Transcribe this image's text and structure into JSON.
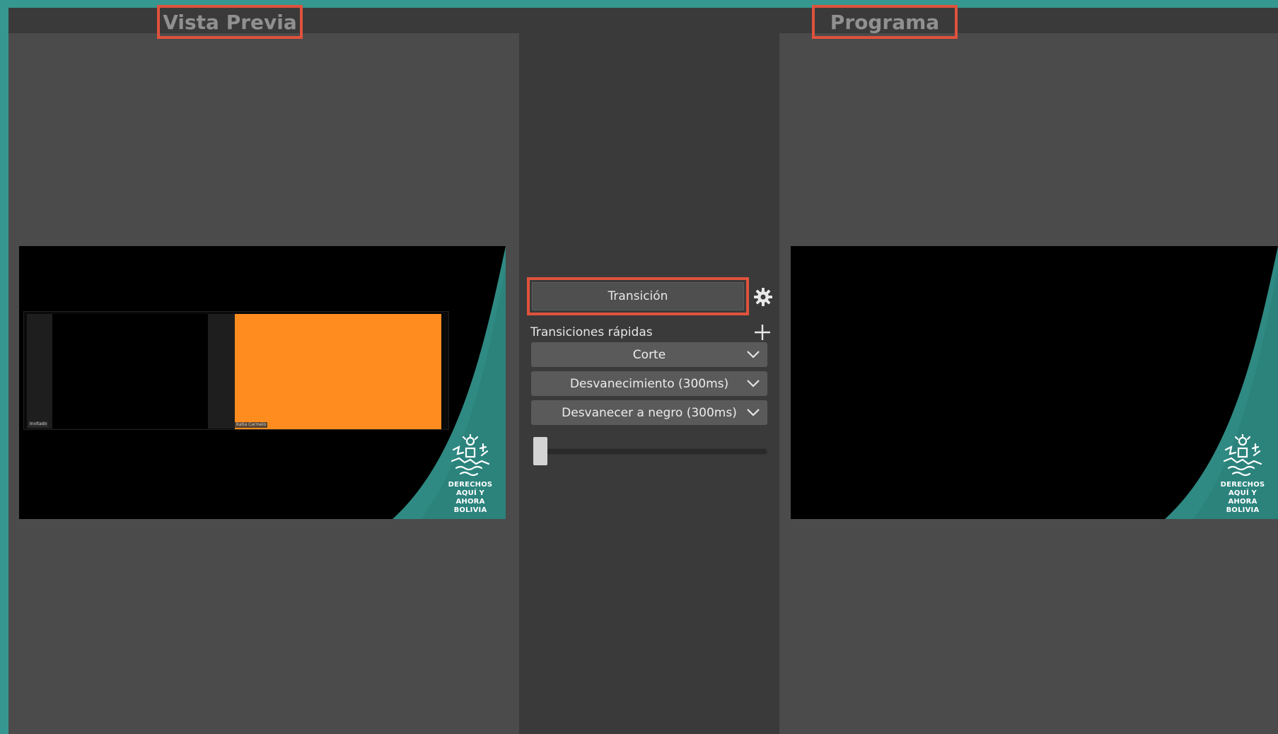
{
  "preview": {
    "title": "Vista Previa",
    "cam_left_label": "Invitado",
    "cam_right_label": "Katia Carmelo",
    "logo_lines": [
      "DERECHOS",
      "AQUÍ Y AHORA",
      "BOLIVIA"
    ]
  },
  "program": {
    "title": "Programa",
    "logo_lines": [
      "DERECHOS",
      "AQUÍ Y AHORA",
      "BOLIVIA"
    ]
  },
  "transitions": {
    "transition_button": "Transición",
    "quick_transitions_label": "Transiciones rápidas",
    "quick": [
      {
        "label": "Corte"
      },
      {
        "label": "Desvanecimiento (300ms)"
      },
      {
        "label": "Desvanecer a negro (300ms)"
      }
    ],
    "slider_value": 0
  },
  "colors": {
    "highlight": "#e0523c",
    "accent_teal": "#369790",
    "camera_orange": "#ff8c1e"
  },
  "icons": [
    "gear-icon",
    "plus-icon",
    "chevron-down-icon"
  ]
}
